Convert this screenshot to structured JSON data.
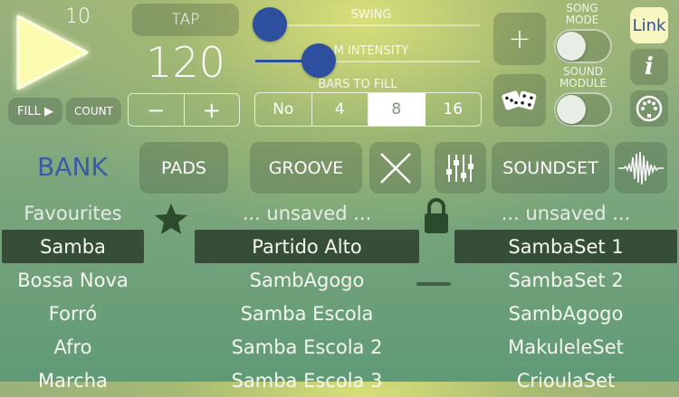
{
  "transport": {
    "play_icon": "play-triangle-icon",
    "bar_count": "10"
  },
  "tempo": {
    "tap_label": "TAP",
    "bpm": "120",
    "minus": "−",
    "plus": "+"
  },
  "fill": {
    "fill_label": "FILL ▶",
    "count_label": "COUNT"
  },
  "sliders": {
    "swing_label": "SWING",
    "swing_value": 0.0,
    "intensity_label": "M INTENSITY",
    "intensity_value": 0.28
  },
  "bars_to_fill": {
    "label": "BARS TO FILL",
    "options": [
      "No",
      "4",
      "8",
      "16"
    ],
    "selected": "8"
  },
  "right_panel": {
    "add_label": "+",
    "song_mode_label": "SONG\nMODE",
    "sound_module_label": "SOUND\nMODULE",
    "link_label": "Link",
    "info_label": "i"
  },
  "sections": {
    "bank_label": "BANK",
    "pads_label": "PADS",
    "groove_label": "GROOVE",
    "soundset_label": "SOUNDSET"
  },
  "bank_list": [
    "Favourites",
    "Samba",
    "Bossa Nova",
    "Forró",
    "Afro",
    "Marcha"
  ],
  "bank_selected": "Samba",
  "groove_list": [
    "... unsaved ...",
    "Partido Alto",
    "SambAgogo",
    "Samba Escola",
    "Samba Escola 2",
    "Samba Escola 3"
  ],
  "groove_selected": "Partido Alto",
  "soundset_list": [
    "... unsaved ...",
    "SambaSet 1",
    "SambaSet 2",
    "SambAgogo",
    "MakuleleSet",
    "CrioulaSet"
  ],
  "soundset_selected": "SambaSet 1",
  "colors": {
    "accent": "#2e4f9d",
    "link_bg": "#f7f6c0",
    "bank_text": "#3b5aa8",
    "play": "#fbfbb0"
  }
}
